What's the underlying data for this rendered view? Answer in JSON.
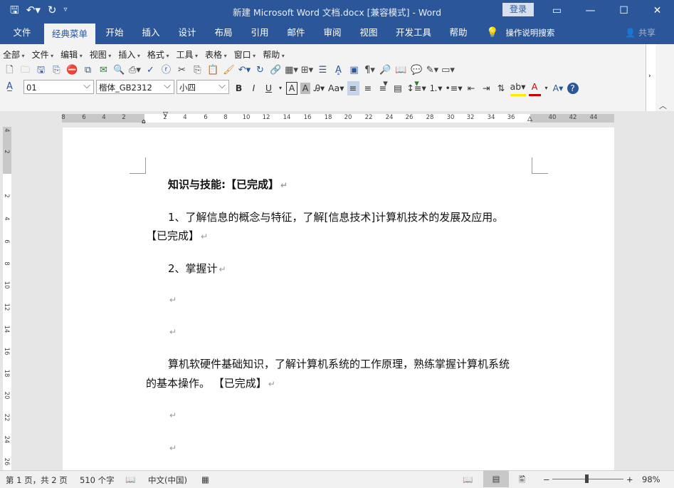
{
  "window": {
    "title": "新建 Microsoft Word 文档.docx [兼容模式]  -  Word",
    "login_label": "登录",
    "controls": [
      "restore-ribbon-icon",
      "minimize-icon",
      "maximize-icon",
      "close-icon"
    ]
  },
  "quick_access": [
    "save-icon",
    "undo-icon",
    "redo-icon",
    "customize-icon"
  ],
  "ribbon_tabs": [
    "文件",
    "经典菜单",
    "开始",
    "插入",
    "设计",
    "布局",
    "引用",
    "邮件",
    "审阅",
    "视图",
    "开发工具",
    "帮助"
  ],
  "active_tab": "经典菜单",
  "tell_me": "操作说明搜索",
  "share": "共享",
  "classic_menu": [
    "全部",
    "文件",
    "编辑",
    "视图",
    "插入",
    "格式",
    "工具",
    "表格",
    "窗口",
    "帮助"
  ],
  "format_bar": {
    "style_value": "01",
    "font_value": "楷体_GB2312",
    "size_value": "小四",
    "buttons": [
      "B",
      "I",
      "U"
    ]
  },
  "horizontal_ruler_ticks": [
    "8",
    "6",
    "4",
    "2",
    "2",
    "4",
    "6",
    "8",
    "10",
    "12",
    "14",
    "16",
    "18",
    "20",
    "22",
    "24",
    "26",
    "28",
    "30",
    "32",
    "34",
    "36",
    "40",
    "42",
    "44"
  ],
  "vertical_ruler_ticks": [
    "4",
    "2",
    "2",
    "4",
    "6",
    "8",
    "10",
    "12",
    "14",
    "16",
    "18",
    "20",
    "22",
    "24",
    "26"
  ],
  "document": {
    "line1": "知识与技能:【已完成】",
    "line2": "1、了解信息的概念与特征，了解[信息技术]计算机技术的发展及应用。",
    "line3": "【已完成】",
    "line4": "2、掌握计",
    "line5": "算机软硬件基础知识，了解计算机系统的工作原理，熟练掌握计算机系统",
    "line6": "的基本操作。 【已完成】",
    "para_mark": "↵"
  },
  "status": {
    "page": "第 1 页，共 2 页",
    "words": "510 个字",
    "language": "中文(中国)",
    "zoom": "98%",
    "zoom_minus": "−",
    "zoom_plus": "+"
  }
}
